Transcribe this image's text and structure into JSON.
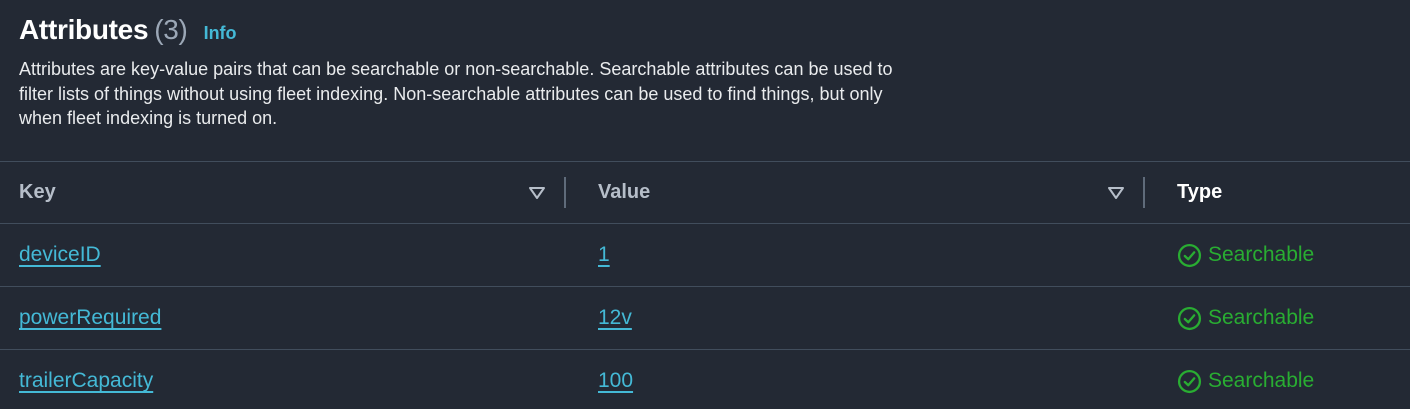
{
  "section": {
    "title": "Attributes",
    "count": "(3)",
    "info_label": "Info",
    "description": "Attributes are key-value pairs that can be searchable or non-searchable. Searchable attributes can be used to filter lists of things without using fleet indexing. Non-searchable attributes can be used to find things, but only when fleet indexing is turned on."
  },
  "table": {
    "columns": {
      "key": "Key",
      "value": "Value",
      "type": "Type"
    },
    "rows": [
      {
        "key": "deviceID",
        "value": "1",
        "type": "Searchable"
      },
      {
        "key": "powerRequired",
        "value": "12v",
        "type": "Searchable"
      },
      {
        "key": "trailerCapacity",
        "value": "100",
        "type": "Searchable"
      }
    ]
  },
  "colors": {
    "background": "#232934",
    "link": "#44b9d6",
    "success": "#29ad32",
    "border": "#414d5c"
  },
  "icons": {
    "sort": "caret-down-outline-icon",
    "status": "check-circle-icon"
  }
}
